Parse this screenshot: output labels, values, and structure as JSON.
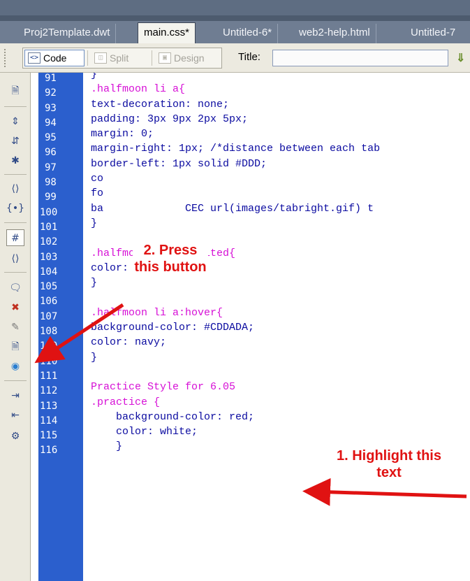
{
  "tabs": [
    "Proj2Template.dwt",
    "main.css*",
    "Untitled-6*",
    "web2-help.html",
    "Untitled-7"
  ],
  "toolbar": {
    "code_label": "Code",
    "split_label": "Split",
    "design_label": "Design",
    "title_label": "Title:",
    "title_value": ""
  },
  "coding_toolbar": {
    "icons": [
      "open-documents-icon",
      "collapse-full-tag-icon",
      "collapse-selection-icon",
      "expand-all-icon",
      "select-parent-tag-icon",
      "balance-braces-icon",
      "line-numbers-icon",
      "highlight-invalid-code-icon",
      "apply-comment-icon",
      "remove-comment-icon",
      "wrap-tag-icon",
      "recent-snippets-icon",
      "move-css-icon",
      "indent-code-icon",
      "outdent-code-icon",
      "format-source-code-icon"
    ]
  },
  "editor": {
    "line_numbers": [
      "91",
      "92",
      "93",
      "94",
      "95",
      "96",
      "97",
      "98",
      "99",
      "100",
      "101",
      "102",
      "103",
      "104",
      "105",
      "106",
      "107",
      "108",
      "109",
      "110",
      "111",
      "112",
      "113",
      "114",
      "115",
      "116"
    ],
    "lines": [
      "}",
      ".halfmoon li a{",
      "text-decoration: none;",
      "padding: 3px 9px 2px 5px;",
      "margin: 0;",
      "margin-right: 1px; /*distance between each tab",
      "border-left: 1px solid #DDD;",
      "co",
      "fo",
      "ba             CEC url(images/tabright.gif) t",
      "}",
      "",
      ".halfmoon li a:visited{",
      "color: black;",
      "}",
      "",
      ".halfmoon li a:hover{",
      "background-color: #CDDADA;",
      "color: navy;",
      "}",
      "",
      "Practice Style for 6.05",
      ".practice {",
      "    background-color: red;",
      "    color: white;",
      "    }"
    ],
    "selector_lines": [
      1,
      12,
      16,
      21,
      22
    ]
  },
  "annotations": {
    "step1_line1": "1.  Highlight this",
    "step1_line2": "text",
    "step2_line1": "2. Press",
    "step2_line2": "this button"
  },
  "colors": {
    "gutter": "#2b5fcd",
    "code_text": "#0a0aa0",
    "selector_text": "#d60fd6",
    "annotation": "#e01212"
  }
}
